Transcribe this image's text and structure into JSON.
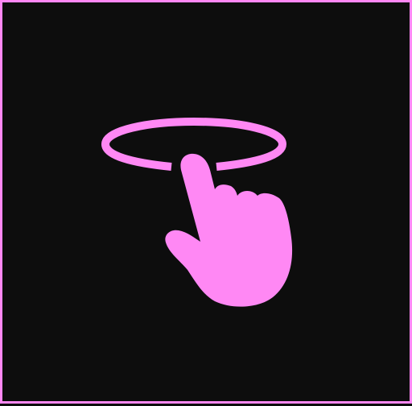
{
  "icon": {
    "name": "rotate-touch-gesture-icon",
    "color": "#ff88f4"
  },
  "background": {
    "color": "#0d0d0d",
    "border_color": "#ff88f4"
  }
}
